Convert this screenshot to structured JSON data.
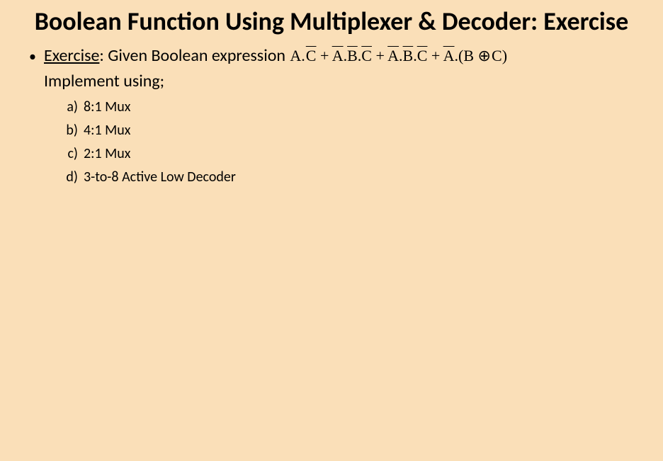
{
  "title": "Boolean Function Using Multiplexer & Decoder: Exercise",
  "bullet": {
    "label": "Exercise",
    "lead": ": Given  Boolean expression  ",
    "expression_parts": {
      "t1a": "A.",
      "t1b": "C",
      "plus": "  +  ",
      "t2a": "A",
      "t2b": ".",
      "t2c": "B",
      "t2d": ".",
      "t2e": "C",
      "t3a": "A",
      "t3b": ".",
      "t3c": "B",
      "t3d": ".",
      "t3e": "C",
      "t4a": "A",
      "t4b": ".(B",
      "t4c": "C)"
    },
    "implement": "Implement using;"
  },
  "items": [
    {
      "letter": "a)",
      "text": "8:1 Mux"
    },
    {
      "letter": "b)",
      "text": "4:1 Mux"
    },
    {
      "letter": "c)",
      "text": "2:1 Mux"
    },
    {
      "letter": "d)",
      "text": "3-to-8 Active Low Decoder"
    }
  ]
}
